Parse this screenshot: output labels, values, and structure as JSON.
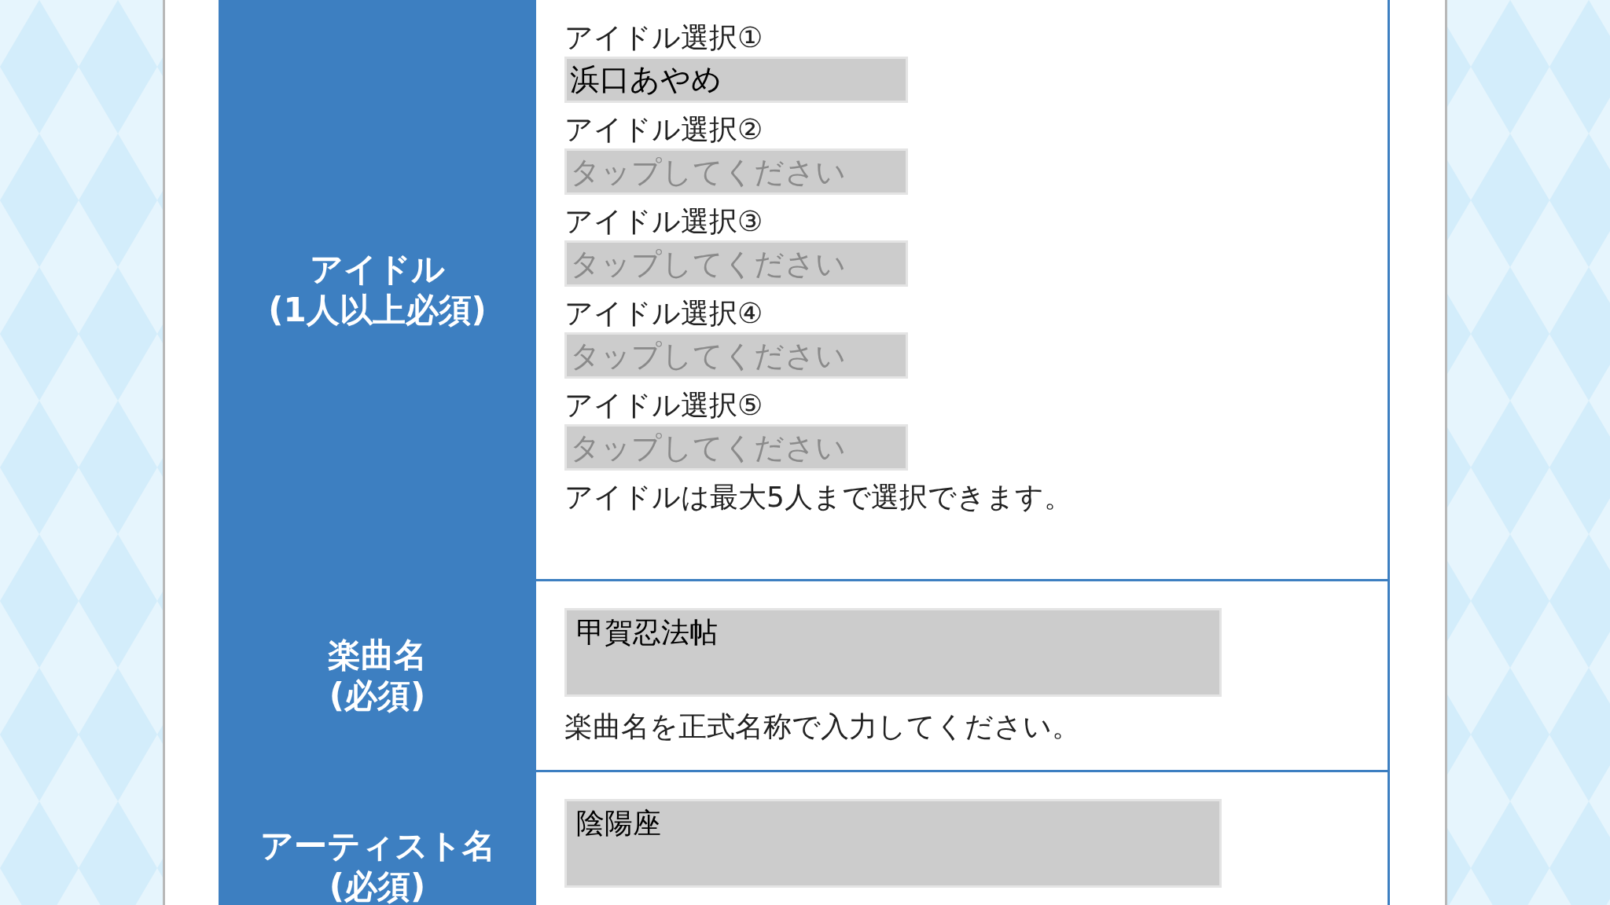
{
  "idol_row": {
    "header_lines": [
      "アイドル",
      "(1人以上必須)"
    ],
    "selections": [
      {
        "label": "アイドル選択①",
        "value": "浜口あやめ"
      },
      {
        "label": "アイドル選択②",
        "placeholder": "タップしてください"
      },
      {
        "label": "アイドル選択③",
        "placeholder": "タップしてください"
      },
      {
        "label": "アイドル選択④",
        "placeholder": "タップしてください"
      },
      {
        "label": "アイドル選択⑤",
        "placeholder": "タップしてください"
      }
    ],
    "note": "アイドルは最大5人まで選択できます。"
  },
  "song_row": {
    "header_lines": [
      "楽曲名",
      "(必須)"
    ],
    "value": "甲賀忍法帖",
    "note": "楽曲名を正式名称で入力してください。"
  },
  "artist_row": {
    "header_lines": [
      "アーティスト名",
      "(必須)"
    ],
    "value": "陰陽座"
  }
}
